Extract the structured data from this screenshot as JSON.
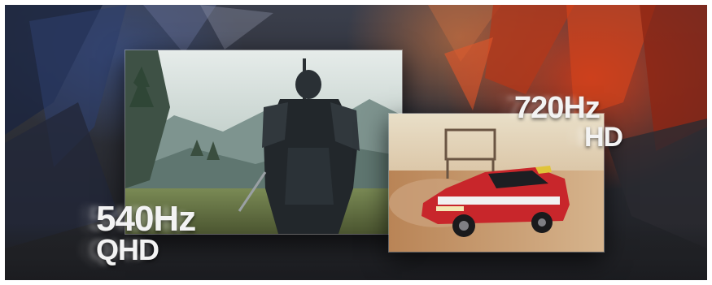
{
  "banner": {
    "left_spec": {
      "refresh_rate": "540Hz",
      "resolution": "QHD"
    },
    "right_spec": {
      "refresh_rate": "720Hz",
      "resolution": "HD"
    }
  }
}
